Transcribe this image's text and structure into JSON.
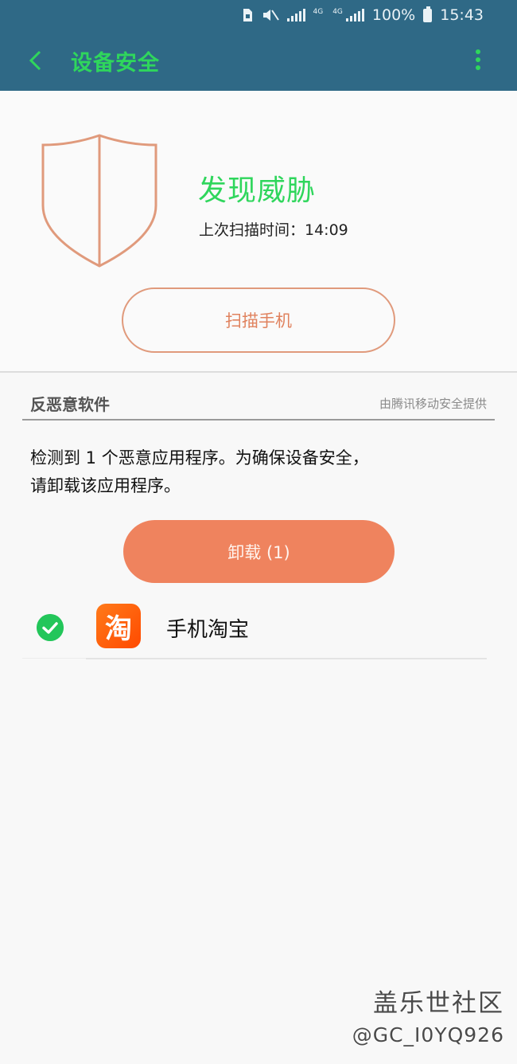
{
  "status_bar": {
    "battery": "100%",
    "time": "15:43",
    "net_tag_1": "4G",
    "net_tag_2": "4G"
  },
  "app_bar": {
    "title": "设备安全"
  },
  "hero": {
    "status_text": "发现威胁",
    "last_scan": "上次扫描时间：14:09",
    "scan_button": "扫描手机"
  },
  "section": {
    "title": "反恶意软件",
    "provider": "由腾讯移动安全提供"
  },
  "message": {
    "line1": "检测到 1 个恶意应用程序。为确保设备安全，",
    "line2": "请卸载该应用程序。"
  },
  "actions": {
    "uninstall_label": "卸载 (1)"
  },
  "apps": [
    {
      "name": "手机淘宝",
      "icon_char": "淘",
      "icon": "taobao-icon"
    }
  ],
  "watermark": {
    "line1": "盖乐世社区",
    "line2": "@GC_I0YQ926"
  },
  "colors": {
    "header": "#2f6986",
    "accent_green": "#2fd65c",
    "warning_orange": "#ef835e",
    "shield_outline": "#e09a7c"
  }
}
